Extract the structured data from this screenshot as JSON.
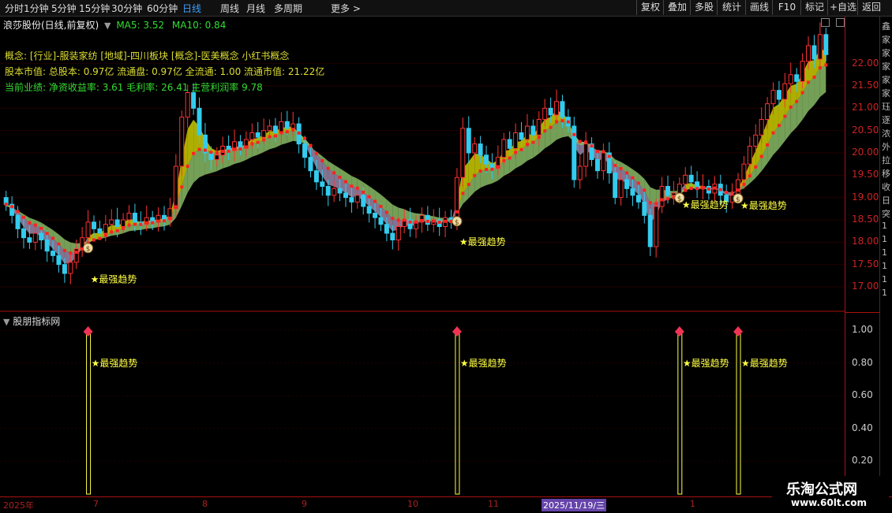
{
  "toolbar": {
    "periods": [
      "分时",
      "1分钟",
      "5分钟",
      "15分钟",
      "30分钟",
      "60分钟",
      "日线",
      "周线",
      "月线",
      "多周期",
      "更多 >"
    ],
    "active_index": 6,
    "buttons": [
      "复权",
      "叠加",
      "多股",
      "统计",
      "画线",
      "F10",
      "标记",
      "+自选",
      "返回"
    ]
  },
  "stock_title": "浪莎股份(日线,前复权)",
  "ma_legend": {
    "ma5": "MA5: 3.52",
    "ma10": "MA10: 0.84"
  },
  "info": {
    "concept": "概念: [行业]-服装家纺 [地域]-四川板块 [概念]-医美概念 小红书概念",
    "capital": "股本市值: 总股本: 0.97亿 流通盘: 0.97亿 全流通: 1.00 流通市值: 21.22亿",
    "performance": "当前业绩: 净资收益率: 3.61 毛利率: 26.41 主营利润率 9.78"
  },
  "price_axis": [
    "22.00",
    "21.50",
    "21.00",
    "20.50",
    "20.00",
    "19.50",
    "19.00",
    "18.50",
    "18.00",
    "17.50",
    "17.00"
  ],
  "indicator_title": "股朋指标网",
  "indicator_axis": [
    "1.00",
    "0.80",
    "0.60",
    "0.40",
    "0.20"
  ],
  "signal_label": "★最强趋势",
  "dates": [
    "2025年",
    "7",
    "8",
    "9",
    "10",
    "11",
    "2025/11/19/三",
    "1"
  ],
  "far_chars": [
    "鑫",
    "家",
    "家",
    "家",
    "家",
    "家",
    "珏",
    "逐",
    "浓",
    "外",
    "拉",
    "移",
    "收",
    "日",
    "突",
    "1",
    "1",
    "1",
    "1",
    "1",
    "1"
  ],
  "watermark": {
    "title": "乐淘公式网",
    "url": "www.60lt.com"
  },
  "colors": {
    "up": "#ff3333",
    "down": "#33ccee",
    "yellow": "#cccc00",
    "green": "#88bb66",
    "lavender": "#9988aa",
    "ma_red": "#ff2222",
    "signal": "#ffff44",
    "axis": "#cc2222"
  },
  "chart_data": {
    "type": "candlestick",
    "ylim": [
      16.7,
      22.7
    ],
    "signal_indices": [
      14,
      77,
      115,
      125
    ],
    "candles": [
      [
        19.0,
        18.85
      ],
      [
        18.85,
        18.6
      ],
      [
        18.6,
        18.3
      ],
      [
        18.3,
        18.1
      ],
      [
        18.1,
        18.0
      ],
      [
        18.0,
        18.2
      ],
      [
        18.2,
        18.05
      ],
      [
        18.05,
        17.8
      ],
      [
        17.8,
        17.7
      ],
      [
        17.7,
        17.5
      ],
      [
        17.5,
        17.3
      ],
      [
        17.3,
        17.55
      ],
      [
        17.55,
        17.85
      ],
      [
        17.85,
        18.1
      ],
      [
        18.1,
        18.45
      ],
      [
        18.45,
        18.3
      ],
      [
        18.3,
        18.2
      ],
      [
        18.2,
        18.4
      ],
      [
        18.4,
        18.5
      ],
      [
        18.5,
        18.35
      ],
      [
        18.35,
        18.5
      ],
      [
        18.5,
        18.65
      ],
      [
        18.65,
        18.45
      ],
      [
        18.45,
        18.4
      ],
      [
        18.4,
        18.55
      ],
      [
        18.55,
        18.45
      ],
      [
        18.45,
        18.6
      ],
      [
        18.6,
        18.5
      ],
      [
        18.5,
        18.75
      ],
      [
        18.75,
        19.7
      ],
      [
        19.7,
        20.8
      ],
      [
        20.8,
        21.35
      ],
      [
        21.35,
        21.0
      ],
      [
        21.0,
        20.4
      ],
      [
        20.4,
        20.0
      ],
      [
        20.0,
        19.85
      ],
      [
        19.85,
        19.95
      ],
      [
        19.95,
        20.15
      ],
      [
        20.15,
        20.05
      ],
      [
        20.05,
        20.25
      ],
      [
        20.25,
        20.1
      ],
      [
        20.1,
        20.3
      ],
      [
        20.3,
        20.45
      ],
      [
        20.45,
        20.35
      ],
      [
        20.35,
        20.5
      ],
      [
        20.5,
        20.6
      ],
      [
        20.6,
        20.45
      ],
      [
        20.45,
        20.7
      ],
      [
        20.7,
        20.55
      ],
      [
        20.55,
        20.65
      ],
      [
        20.65,
        20.2
      ],
      [
        20.2,
        19.9
      ],
      [
        19.9,
        19.6
      ],
      [
        19.6,
        19.35
      ],
      [
        19.35,
        19.25
      ],
      [
        19.25,
        19.05
      ],
      [
        19.05,
        19.2
      ],
      [
        19.2,
        19.1
      ],
      [
        19.1,
        19.0
      ],
      [
        19.0,
        18.9
      ],
      [
        18.9,
        19.05
      ],
      [
        19.05,
        18.8
      ],
      [
        18.8,
        18.65
      ],
      [
        18.65,
        18.55
      ],
      [
        18.55,
        18.4
      ],
      [
        18.4,
        18.2
      ],
      [
        18.2,
        18.05
      ],
      [
        18.05,
        18.35
      ],
      [
        18.35,
        18.5
      ],
      [
        18.5,
        18.3
      ],
      [
        18.3,
        18.45
      ],
      [
        18.45,
        18.6
      ],
      [
        18.6,
        18.4
      ],
      [
        18.4,
        18.5
      ],
      [
        18.5,
        18.35
      ],
      [
        18.35,
        18.55
      ],
      [
        18.55,
        18.45
      ],
      [
        18.45,
        19.45
      ],
      [
        19.45,
        20.55
      ],
      [
        20.55,
        20.0
      ],
      [
        20.0,
        20.2
      ],
      [
        20.2,
        19.95
      ],
      [
        19.95,
        19.75
      ],
      [
        19.75,
        19.65
      ],
      [
        19.65,
        19.9
      ],
      [
        19.9,
        20.3
      ],
      [
        20.3,
        20.1
      ],
      [
        20.1,
        20.45
      ],
      [
        20.45,
        20.3
      ],
      [
        20.3,
        20.6
      ],
      [
        20.6,
        20.4
      ],
      [
        20.4,
        20.75
      ],
      [
        20.75,
        21.0
      ],
      [
        21.0,
        20.85
      ],
      [
        20.85,
        21.15
      ],
      [
        21.15,
        20.8
      ],
      [
        20.8,
        20.6
      ],
      [
        20.6,
        19.4
      ],
      [
        19.4,
        19.7
      ],
      [
        19.7,
        20.2
      ],
      [
        20.2,
        19.85
      ],
      [
        19.85,
        19.6
      ],
      [
        19.6,
        20.0
      ],
      [
        20.0,
        19.55
      ],
      [
        19.55,
        19.0
      ],
      [
        19.0,
        19.4
      ],
      [
        19.4,
        19.2
      ],
      [
        19.2,
        19.05
      ],
      [
        19.05,
        18.9
      ],
      [
        18.9,
        18.6
      ],
      [
        18.6,
        17.9
      ],
      [
        17.9,
        18.8
      ],
      [
        18.8,
        19.25
      ],
      [
        19.25,
        19.05
      ],
      [
        19.05,
        19.1
      ],
      [
        19.1,
        19.3
      ],
      [
        19.3,
        19.5
      ],
      [
        19.5,
        19.35
      ],
      [
        19.35,
        19.2
      ],
      [
        19.2,
        19.25
      ],
      [
        19.25,
        19.1
      ],
      [
        19.1,
        19.3
      ],
      [
        19.3,
        19.05
      ],
      [
        19.05,
        18.9
      ],
      [
        18.9,
        19.05
      ],
      [
        19.05,
        19.4
      ],
      [
        19.4,
        19.75
      ],
      [
        19.75,
        20.15
      ],
      [
        20.15,
        20.4
      ],
      [
        20.4,
        20.75
      ],
      [
        20.75,
        21.1
      ],
      [
        21.1,
        21.4
      ],
      [
        21.4,
        21.2
      ],
      [
        21.2,
        21.55
      ],
      [
        21.55,
        21.75
      ],
      [
        21.75,
        21.6
      ],
      [
        21.6,
        22.05
      ],
      [
        22.05,
        22.4
      ],
      [
        22.4,
        22.1
      ],
      [
        22.1,
        22.65
      ],
      [
        22.65,
        22.2
      ]
    ]
  }
}
